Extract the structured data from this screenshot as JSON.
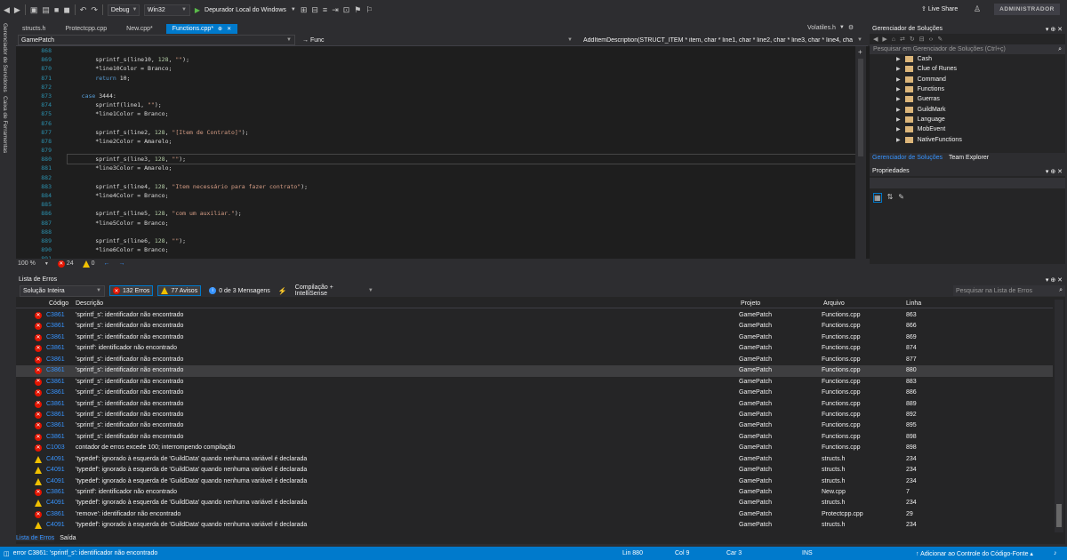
{
  "toolbar": {
    "config": "Debug",
    "platform": "Win32",
    "run_label": "Depurador Local do Windows",
    "live_share": "Live Share",
    "admin": "ADMINISTRADOR"
  },
  "side_tabs": [
    "Gerenciador de Servidores",
    "Caixa de Ferramentas"
  ],
  "doc_tabs": [
    {
      "label": "structs.h"
    },
    {
      "label": "Protectcpp.cpp"
    },
    {
      "label": "New.cpp*"
    },
    {
      "label": "Functions.cpp*",
      "active": true
    }
  ],
  "volatiles_tab": "Volatiles.h",
  "nav": {
    "project": "GamePatch",
    "scope": "→ Func",
    "member": "AddItemDescription(STRUCT_ITEM * item, char * line1, char * line2, char * line3, char * line4, cha"
  },
  "editor": {
    "lines": [
      {
        "n": "868",
        "t": ""
      },
      {
        "n": "869",
        "t": "        sprintf_s(line10, 128, \"\");"
      },
      {
        "n": "870",
        "t": "        *line10Color = Branco;"
      },
      {
        "n": "871",
        "t": "        return 10;"
      },
      {
        "n": "872",
        "t": ""
      },
      {
        "n": "873",
        "t": "    case 3444:"
      },
      {
        "n": "874",
        "t": "        sprintf(line1, \"\");"
      },
      {
        "n": "875",
        "t": "        *line1Color = Branco;"
      },
      {
        "n": "876",
        "t": ""
      },
      {
        "n": "877",
        "t": "        sprintf_s(line2, 128, \"[Item de Contrato]\");"
      },
      {
        "n": "878",
        "t": "        *line2Color = Amarelo;"
      },
      {
        "n": "879",
        "t": ""
      },
      {
        "n": "880",
        "t": "        sprintf_s(line3, 128, \"\");",
        "current": true
      },
      {
        "n": "881",
        "t": "        *line3Color = Amarelo;"
      },
      {
        "n": "882",
        "t": ""
      },
      {
        "n": "883",
        "t": "        sprintf_s(line4, 128, \"Item necessário para fazer contrato\");"
      },
      {
        "n": "884",
        "t": "        *line4Color = Branco;"
      },
      {
        "n": "885",
        "t": ""
      },
      {
        "n": "886",
        "t": "        sprintf_s(line5, 128, \"com um auxiliar.\");"
      },
      {
        "n": "887",
        "t": "        *line5Color = Branco;"
      },
      {
        "n": "888",
        "t": ""
      },
      {
        "n": "889",
        "t": "        sprintf_s(line6, 128, \"\");"
      },
      {
        "n": "890",
        "t": "        *line6Color = Branco;"
      },
      {
        "n": "891",
        "t": ""
      }
    ],
    "zoom": "100 %",
    "errors": "24",
    "warnings": "0"
  },
  "solution": {
    "title": "Gerenciador de Soluções",
    "search_placeholder": "Pesquisar em Gerenciador de Soluções (Ctrl+ç)",
    "items": [
      "Cash",
      "Clue of Runes",
      "Command",
      "Functions",
      "Guerras",
      "GuildMark",
      "Language",
      "MobEvent",
      "NativeFunctions"
    ],
    "tabs": [
      "Gerenciador de Soluções",
      "Team Explorer"
    ]
  },
  "properties": {
    "title": "Propriedades"
  },
  "errors": {
    "title": "Lista de Erros",
    "scope": "Solução Inteira",
    "errors_btn": "132 Erros",
    "warnings_btn": "77 Avisos",
    "messages_btn": "0 de 3 Mensagens",
    "build_filter": "Compilação + IntelliSense",
    "search_placeholder": "Pesquisar na Lista de Erros",
    "headers": {
      "code": "Código",
      "desc": "Descrição",
      "project": "Projeto",
      "file": "Arquivo",
      "line": "Linha"
    },
    "rows": [
      {
        "type": "error",
        "code": "C3861",
        "desc": "'sprintf_s': identificador não encontrado",
        "project": "GamePatch",
        "file": "Functions.cpp",
        "line": "863"
      },
      {
        "type": "error",
        "code": "C3861",
        "desc": "'sprintf_s': identificador não encontrado",
        "project": "GamePatch",
        "file": "Functions.cpp",
        "line": "866"
      },
      {
        "type": "error",
        "code": "C3861",
        "desc": "'sprintf_s': identificador não encontrado",
        "project": "GamePatch",
        "file": "Functions.cpp",
        "line": "869"
      },
      {
        "type": "error",
        "code": "C3861",
        "desc": "'sprintf': identificador não encontrado",
        "project": "GamePatch",
        "file": "Functions.cpp",
        "line": "874"
      },
      {
        "type": "error",
        "code": "C3861",
        "desc": "'sprintf_s': identificador não encontrado",
        "project": "GamePatch",
        "file": "Functions.cpp",
        "line": "877"
      },
      {
        "type": "error",
        "code": "C3861",
        "desc": "'sprintf_s': identificador não encontrado",
        "project": "GamePatch",
        "file": "Functions.cpp",
        "line": "880",
        "selected": true
      },
      {
        "type": "error",
        "code": "C3861",
        "desc": "'sprintf_s': identificador não encontrado",
        "project": "GamePatch",
        "file": "Functions.cpp",
        "line": "883"
      },
      {
        "type": "error",
        "code": "C3861",
        "desc": "'sprintf_s': identificador não encontrado",
        "project": "GamePatch",
        "file": "Functions.cpp",
        "line": "886"
      },
      {
        "type": "error",
        "code": "C3861",
        "desc": "'sprintf_s': identificador não encontrado",
        "project": "GamePatch",
        "file": "Functions.cpp",
        "line": "889"
      },
      {
        "type": "error",
        "code": "C3861",
        "desc": "'sprintf_s': identificador não encontrado",
        "project": "GamePatch",
        "file": "Functions.cpp",
        "line": "892"
      },
      {
        "type": "error",
        "code": "C3861",
        "desc": "'sprintf_s': identificador não encontrado",
        "project": "GamePatch",
        "file": "Functions.cpp",
        "line": "895"
      },
      {
        "type": "error",
        "code": "C3861",
        "desc": "'sprintf_s': identificador não encontrado",
        "project": "GamePatch",
        "file": "Functions.cpp",
        "line": "898"
      },
      {
        "type": "error",
        "code": "C1003",
        "desc": "contador de erros excede 100; interrompendo compilação",
        "project": "GamePatch",
        "file": "Functions.cpp",
        "line": "898"
      },
      {
        "type": "warning",
        "code": "C4091",
        "desc": "'typedef': ignorado à esquerda de 'GuildData' quando nenhuma variável é declarada",
        "project": "GamePatch",
        "file": "structs.h",
        "line": "234"
      },
      {
        "type": "warning",
        "code": "C4091",
        "desc": "'typedef': ignorado à esquerda de 'GuildData' quando nenhuma variável é declarada",
        "project": "GamePatch",
        "file": "structs.h",
        "line": "234"
      },
      {
        "type": "warning",
        "code": "C4091",
        "desc": "'typedef': ignorado à esquerda de 'GuildData' quando nenhuma variável é declarada",
        "project": "GamePatch",
        "file": "structs.h",
        "line": "234"
      },
      {
        "type": "error",
        "code": "C3861",
        "desc": "'sprintf': identificador não encontrado",
        "project": "GamePatch",
        "file": "New.cpp",
        "line": "7"
      },
      {
        "type": "warning",
        "code": "C4091",
        "desc": "'typedef': ignorado à esquerda de 'GuildData' quando nenhuma variável é declarada",
        "project": "GamePatch",
        "file": "structs.h",
        "line": "234"
      },
      {
        "type": "error",
        "code": "C3861",
        "desc": "'remove': identificador não encontrado",
        "project": "GamePatch",
        "file": "Protectcpp.cpp",
        "line": "29"
      },
      {
        "type": "warning",
        "code": "C4091",
        "desc": "'typedef': ignorado à esquerda de 'GuildData' quando nenhuma variável é declarada",
        "project": "GamePatch",
        "file": "structs.h",
        "line": "234"
      }
    ],
    "bottom_tabs": [
      "Lista de Erros",
      "Saída"
    ]
  },
  "status": {
    "message": "error C3861: 'sprintf_s': identificador não encontrado",
    "line": "Lin 880",
    "col": "Col 9",
    "car": "Car 3",
    "ins": "INS",
    "source_control": "Adicionar ao Controle do Código-Fonte"
  },
  "colors": {
    "accent": "#007acc",
    "error": "#e51400",
    "warning": "#f0c000",
    "background": "#1e1e1e"
  }
}
